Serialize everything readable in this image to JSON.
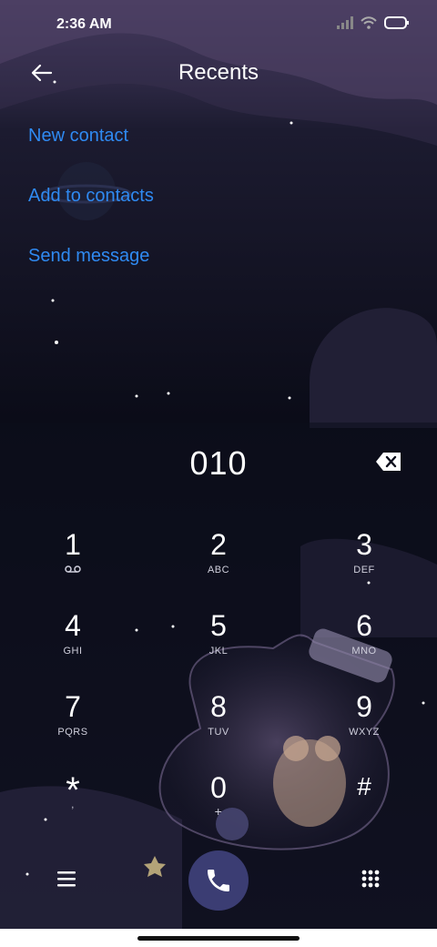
{
  "status_bar": {
    "time": "2:36 AM"
  },
  "header": {
    "title": "Recents"
  },
  "menu": {
    "new_contact": "New contact",
    "add_to_contacts": "Add to contacts",
    "send_message": "Send message"
  },
  "dialer": {
    "number": "010",
    "keys": [
      {
        "digit": "1",
        "letters": ""
      },
      {
        "digit": "2",
        "letters": "ABC"
      },
      {
        "digit": "3",
        "letters": "DEF"
      },
      {
        "digit": "4",
        "letters": "GHI"
      },
      {
        "digit": "5",
        "letters": "JKL"
      },
      {
        "digit": "6",
        "letters": "MNO"
      },
      {
        "digit": "7",
        "letters": "PQRS"
      },
      {
        "digit": "8",
        "letters": "TUV"
      },
      {
        "digit": "9",
        "letters": "WXYZ"
      },
      {
        "digit": "*",
        "letters": ","
      },
      {
        "digit": "0",
        "letters": "+"
      },
      {
        "digit": "#",
        "letters": ""
      }
    ]
  },
  "colors": {
    "link": "#2f8af2",
    "call_button": "#3b3d73",
    "background": "#0b0c18"
  },
  "icons": [
    "back-arrow-icon",
    "backspace-icon",
    "voicemail-icon",
    "menu-icon",
    "phone-icon",
    "dialpad-icon",
    "signal-icon",
    "wifi-icon",
    "battery-icon"
  ]
}
